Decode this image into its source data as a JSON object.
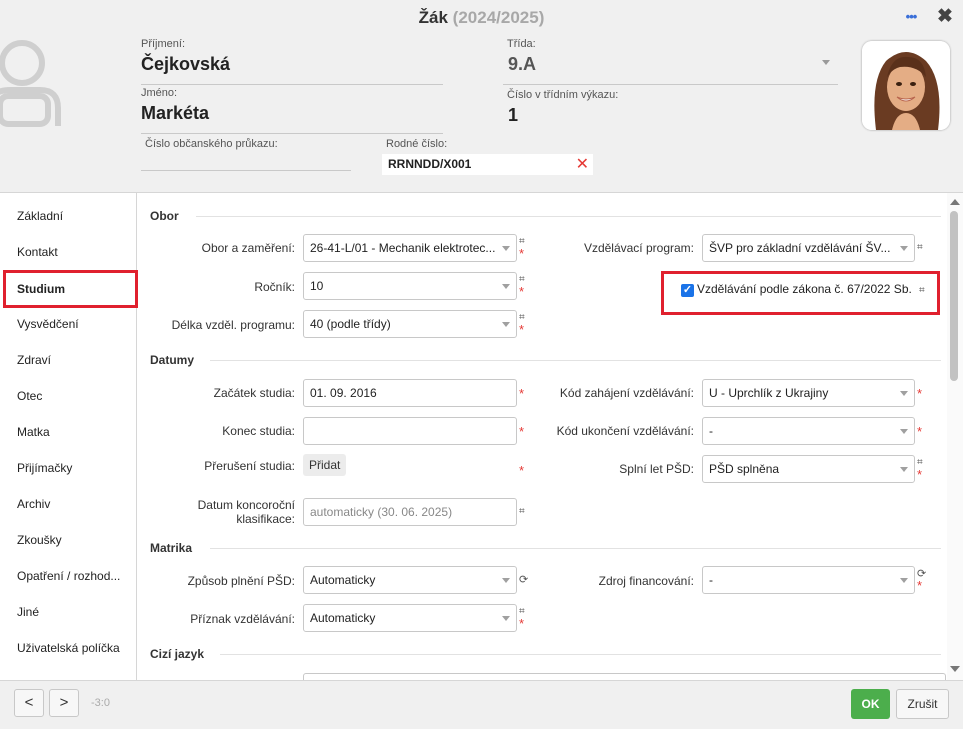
{
  "window": {
    "title": "Žák",
    "school_year": "(2024/2025)",
    "more_icon": "ellipsis-icon",
    "close_icon": "close-icon"
  },
  "student": {
    "surname_label": "Příjmení:",
    "surname": "Čejkovská",
    "name_label": "Jméno:",
    "name": "Markéta",
    "id_card_label": "Číslo občanského průkazu:",
    "id_card": "",
    "birth_number_label": "Rodné číslo:",
    "birth_number": "RRNNDD/X001",
    "class_label": "Třída:",
    "class": "9.A",
    "class_report_label": "Číslo v třídním výkazu:",
    "class_report_number": "1"
  },
  "sidebar": {
    "items": [
      {
        "label": "Základní"
      },
      {
        "label": "Kontakt"
      },
      {
        "label": "Studium"
      },
      {
        "label": "Vysvědčení"
      },
      {
        "label": "Zdraví"
      },
      {
        "label": "Otec"
      },
      {
        "label": "Matka"
      },
      {
        "label": "Přijímačky"
      },
      {
        "label": "Archiv"
      },
      {
        "label": "Zkoušky"
      },
      {
        "label": "Opatření / rozhod..."
      },
      {
        "label": "Jiné"
      },
      {
        "label": "Uživatelská políčka"
      }
    ]
  },
  "sections": {
    "obor": "Obor",
    "datumy": "Datumy",
    "matrika": "Matrika",
    "cizi_jazyk": "Cizí jazyk"
  },
  "fields": {
    "obor_label": "Obor a zaměření:",
    "obor_value": "26-41-L/01 - Mechanik elektrotec...",
    "rocnik_label": "Ročník:",
    "rocnik_value": "10",
    "delka_label": "Délka vzděl. programu:",
    "delka_value": "40 (podle třídy)",
    "program_label": "Vzdělávací program:",
    "program_value": "ŠVP pro základní vzdělávání ŠV...",
    "zakon_label": "Vzdělávání podle zákona č. 67/2022 Sb.",
    "zakon_checked": "✓",
    "zacatek_label": "Začátek studia:",
    "zacatek_value": "01. 09. 2016",
    "konec_label": "Konec studia:",
    "konec_value": "",
    "preruseni_label": "Přerušení studia:",
    "preruseni_button": "Přidat",
    "koncorocni_label_1": "Datum koncoroční",
    "koncorocni_label_2": "klasifikace:",
    "koncorocni_value": "automaticky (30. 06. 2025)",
    "kod_zahajeni_label": "Kód zahájení vzdělávání:",
    "kod_zahajeni_value": "U - Uprchlík z Ukrajiny",
    "kod_ukonceni_label": "Kód ukončení vzdělávání:",
    "kod_ukonceni_value": "-",
    "psd_label": "Splní let PŠD:",
    "psd_value": "PŠD splněna",
    "zpusob_label": "Způsob plnění PŠD:",
    "zpusob_value": "Automaticky",
    "priznak_label": "Příznak vzdělávání:",
    "priznak_value": "Automaticky",
    "zdroj_label": "Zdroj financování:",
    "zdroj_value": "-"
  },
  "marks": {
    "hash": "⌗",
    "req": "*",
    "refresh": "⟳"
  },
  "footer": {
    "prev": "<",
    "next": ">",
    "counter": "-3:0",
    "ok": "OK",
    "cancel": "Zrušit"
  },
  "colors": {
    "highlight": "#e0202e",
    "ok_button": "#4cae4c",
    "required": "#e53935"
  }
}
